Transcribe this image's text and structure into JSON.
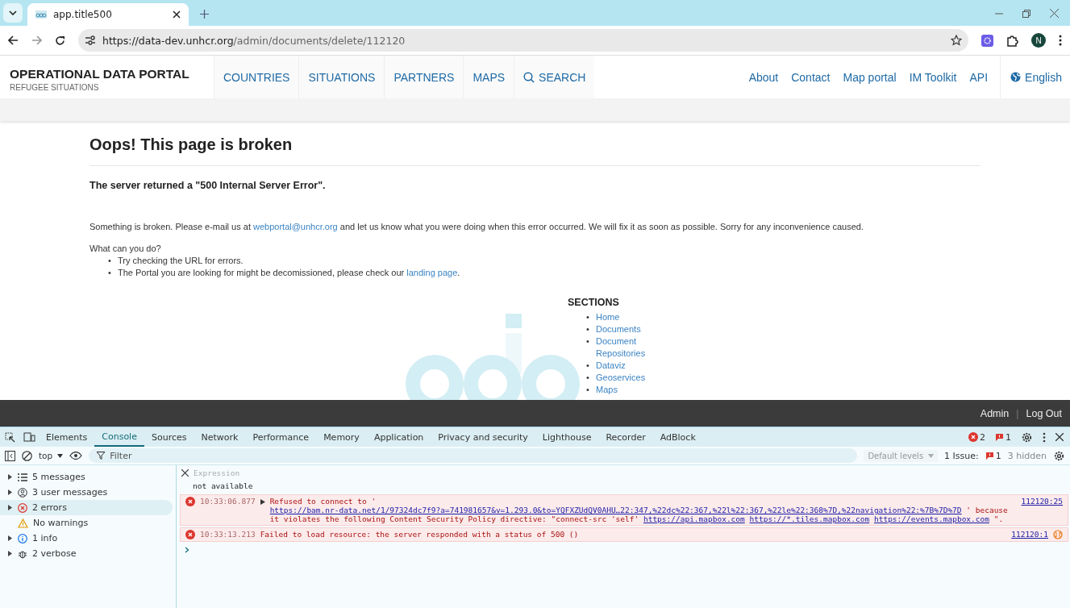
{
  "browser": {
    "tab_title": "app.title500",
    "url_host": "https://data-dev.unhcr.org",
    "url_path": "/admin/documents/delete/112120",
    "profile_initial": "N"
  },
  "site_header": {
    "title": "OPERATIONAL DATA PORTAL",
    "subtitle": "REFUGEE SITUATIONS",
    "nav": [
      "COUNTRIES",
      "SITUATIONS",
      "PARTNERS",
      "MAPS"
    ],
    "search": "SEARCH",
    "links": [
      "About",
      "Contact",
      "Map portal",
      "IM Toolkit",
      "API"
    ],
    "language": "English"
  },
  "content": {
    "heading": "Oops! This page is broken",
    "subheading": "The server returned a \"500 Internal Server Error\".",
    "message_before": "Something is broken. Please e-mail us at",
    "email": "webportal@unhcr.org",
    "message_after": "and let us know what you were doing when this error occurred. We will fix it as soon as possible. Sorry for any inconvenience caused.",
    "question": "What can you do?",
    "tips": [
      {
        "text": "Try checking the URL for errors."
      },
      {
        "text": "The Portal you are looking for might be decomissioned, please check our",
        "link": "landing page",
        "after": "."
      }
    ]
  },
  "sections": {
    "title": "SECTIONS",
    "items": [
      "Home",
      "Documents",
      "Document Repositories",
      "Dataviz",
      "Geoservices",
      "Maps"
    ]
  },
  "bullet": "•",
  "footer": {
    "links": [
      "Admin",
      "Log Out"
    ],
    "separator": "|"
  },
  "devtools": {
    "tabs": [
      {
        "label": "Elements",
        "selected": false
      },
      {
        "label": "Console",
        "selected": true
      },
      {
        "label": "Sources",
        "selected": false
      },
      {
        "label": "Network",
        "selected": false
      },
      {
        "label": "Performance",
        "selected": false
      },
      {
        "label": "Memory",
        "selected": false
      },
      {
        "label": "Application",
        "selected": false
      },
      {
        "label": "Privacy and security",
        "selected": false
      },
      {
        "label": "Lighthouse",
        "selected": false
      },
      {
        "label": "Recorder",
        "selected": false
      },
      {
        "label": "AdBlock",
        "selected": false
      }
    ],
    "error_count": "2",
    "issue_count": "1",
    "context": "top",
    "filter_placeholder": "Filter",
    "levels": "Default levels",
    "issues_label": "1 Issue:",
    "issues_badge": "1",
    "hidden": "3 hidden",
    "sidebar": [
      {
        "kind": "list",
        "label": "5 messages",
        "selected": false
      },
      {
        "kind": "user",
        "label": "3 user messages",
        "selected": false
      },
      {
        "kind": "error",
        "label": "2 errors",
        "selected": true
      },
      {
        "kind": "warning",
        "label": "No warnings",
        "selected": false
      },
      {
        "kind": "info",
        "label": "1 info",
        "selected": false
      },
      {
        "kind": "verbose",
        "label": "2 verbose",
        "selected": false
      }
    ],
    "expression": {
      "placeholder": "Expression",
      "value": "not available"
    },
    "messages": [
      {
        "time": "10:33:06.877",
        "expanded": false,
        "source": "112120:25",
        "parts": [
          {
            "kind": "text",
            "text": "Refused to connect to '"
          },
          {
            "kind": "link",
            "text": "https://bam.nr-data.net/1/97324dc7f9?a=741981657&v=1.293.0&to=YQFXZUdQV0AHU…22:347,%22dc%22:367,%22l%22:367,%22le%22:368%7D,%22navigation%22:%7B%7D%7D"
          },
          {
            "kind": "text",
            "text": "' because it violates the following Content Security Policy directive: \"connect-src 'self'"
          },
          {
            "kind": "link",
            "text": "https://api.mapbox.com"
          },
          {
            "kind": "link",
            "text": "https://*.tiles.mapbox.com"
          },
          {
            "kind": "link",
            "text": "https://events.mapbox.com"
          },
          {
            "kind": "text",
            "text": "\"."
          }
        ]
      },
      {
        "time": "10:33:13.213",
        "source": "112120:1",
        "network": true,
        "parts": [
          {
            "kind": "text",
            "text": "Failed to load resource: the server responded with a status of 500 ()"
          }
        ]
      }
    ]
  }
}
